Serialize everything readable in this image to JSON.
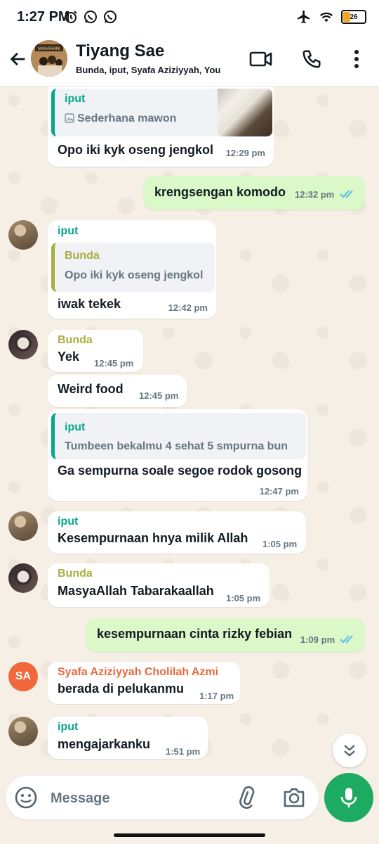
{
  "status_bar": {
    "time": "1:27 PM",
    "battery": "26"
  },
  "header": {
    "title": "Tiyang Sae",
    "subtitle": "Bunda, iput, Syafa Aziziyyah, You",
    "avatar_text": "MAHARANI"
  },
  "messages": [
    {
      "quote_sender": "iput",
      "quote_text": "Sederhana mawon",
      "text": "Opo iki kyk oseng jengkol",
      "time": "12:29 pm"
    },
    {
      "text": "krengsengan komodo",
      "time": "12:32 pm"
    },
    {
      "sender": "iput",
      "quote_sender": "Bunda",
      "quote_text": "Opo iki kyk oseng jengkol",
      "text": "iwak tekek",
      "time": "12:42 pm"
    },
    {
      "sender": "Bunda",
      "text": "Yek",
      "time": "12:45 pm"
    },
    {
      "text": "Weird food",
      "time": "12:45 pm"
    },
    {
      "quote_sender": "iput",
      "quote_text": "Tumbeen bekalmu 4 sehat 5 smpurna bun",
      "text": "Ga sempurna soale segoe rodok gosong",
      "time": "12:47 pm"
    },
    {
      "sender": "iput",
      "text": "Kesempurnaan hnya milik Allah",
      "time": "1:05 pm"
    },
    {
      "sender": "Bunda",
      "text": "MasyaAllah Tabarakaallah",
      "time": "1:05 pm"
    },
    {
      "text": "kesempurnaan cinta rizky febian",
      "time": "1:09 pm"
    },
    {
      "sender": "Syafa Aziziyyah Cholilah Azmi",
      "avatar": "SA",
      "text": "berada di pelukanmu",
      "time": "1:17 pm"
    },
    {
      "sender": "iput",
      "text": "mengajarkanku",
      "time": "1:51 pm"
    }
  ],
  "composer": {
    "placeholder": "Message"
  },
  "colors": {
    "accent": "#1daa61",
    "iput": "#06a88a",
    "bunda": "#a8b042",
    "syafa": "#e8683c",
    "read_ticks": "#53bdeb",
    "outgoing_bubble": "#dbf8c9"
  }
}
